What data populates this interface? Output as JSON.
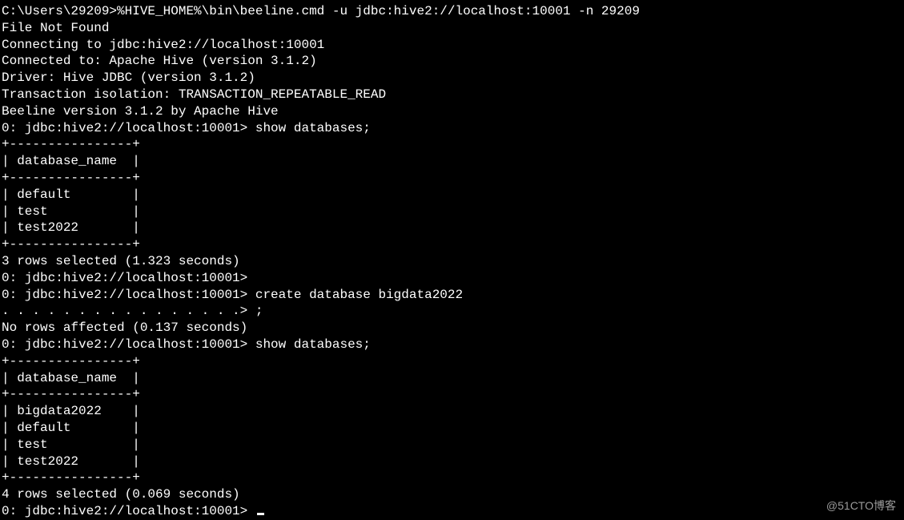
{
  "lines": {
    "l0": "C:\\Users\\29209>%HIVE_HOME%\\bin\\beeline.cmd -u jdbc:hive2://localhost:10001 -n 29209",
    "l1": "File Not Found",
    "l2": "Connecting to jdbc:hive2://localhost:10001",
    "l3": "Connected to: Apache Hive (version 3.1.2)",
    "l4": "Driver: Hive JDBC (version 3.1.2)",
    "l5": "Transaction isolation: TRANSACTION_REPEATABLE_READ",
    "l6": "Beeline version 3.1.2 by Apache Hive",
    "l7": "0: jdbc:hive2://localhost:10001> show databases;",
    "l8": "+----------------+",
    "l9": "| database_name  |",
    "l10": "+----------------+",
    "l11": "| default        |",
    "l12": "| test           |",
    "l13": "| test2022       |",
    "l14": "+----------------+",
    "l15": "3 rows selected (1.323 seconds)",
    "l16": "0: jdbc:hive2://localhost:10001>",
    "l17": "0: jdbc:hive2://localhost:10001> create database bigdata2022",
    "l18": ". . . . . . . . . . . . . . . .> ;",
    "l19": "No rows affected (0.137 seconds)",
    "l20": "0: jdbc:hive2://localhost:10001> show databases;",
    "l21": "+----------------+",
    "l22": "| database_name  |",
    "l23": "+----------------+",
    "l24": "| bigdata2022    |",
    "l25": "| default        |",
    "l26": "| test           |",
    "l27": "| test2022       |",
    "l28": "+----------------+",
    "l29": "4 rows selected (0.069 seconds)",
    "l30": "0: jdbc:hive2://localhost:10001> "
  },
  "watermark": "@51CTO博客"
}
